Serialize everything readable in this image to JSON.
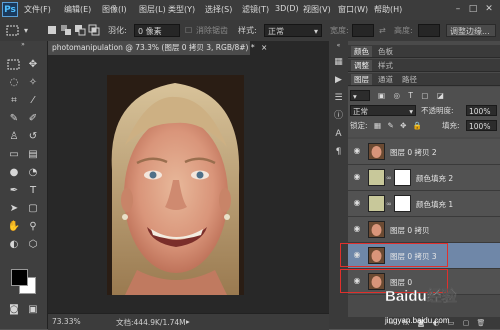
{
  "app": {
    "logo": "Ps"
  },
  "menubar": {
    "items": [
      "文件(F)",
      "编辑(E)",
      "图像(I)",
      "图层(L)",
      "类型(Y)",
      "选择(S)",
      "滤镜(T)",
      "3D(D)",
      "视图(V)",
      "窗口(W)",
      "帮助(H)"
    ],
    "window_buttons": [
      "–",
      "□",
      "✕"
    ]
  },
  "options_bar": {
    "feather_label": "羽化:",
    "feather_value": "0 像素",
    "antialias_label": "消除锯齿",
    "style_label": "样式:",
    "style_value": "正常",
    "width_label": "宽度:",
    "height_label": "高度:",
    "refine_edge_label": "调整边缘..."
  },
  "document": {
    "tab_title": "photomanipulation @ 73.3% (图层 0 拷贝 3, RGB/8#) *",
    "tab_close": "×",
    "zoom": "73.33%",
    "doc_size": "文档:444.9K/1.74M"
  },
  "panels": {
    "top_tabs": [
      "颜色",
      "色板"
    ],
    "mid_tabs": [
      "调整",
      "样式"
    ],
    "layer_tabs": [
      "图层",
      "通道",
      "路径"
    ],
    "blend_mode": "正常",
    "opacity_label": "不透明度:",
    "opacity_value": "100%",
    "lock_label": "锁定:",
    "fill_label": "填充:",
    "fill_value": "100%",
    "layers": [
      {
        "name": "图层 0 拷贝 2",
        "thumb": "face",
        "selected": false,
        "boxed": false
      },
      {
        "name": "颜色填充 2",
        "thumb": "fill",
        "selected": false,
        "boxed": false
      },
      {
        "name": "颜色填充 1",
        "thumb": "fill",
        "selected": false,
        "boxed": false
      },
      {
        "name": "图层 0 拷贝",
        "thumb": "face",
        "selected": false,
        "boxed": false
      },
      {
        "name": "图层 0 拷贝 3",
        "thumb": "face",
        "selected": true,
        "boxed": true
      },
      {
        "name": "图层 0",
        "thumb": "face",
        "selected": false,
        "boxed": true
      }
    ],
    "footer_icons": [
      "link-icon",
      "fx-icon",
      "mask-icon",
      "adjustment-icon",
      "folder-icon",
      "new-layer-icon",
      "trash-icon"
    ]
  },
  "watermark": {
    "text": "Baidu经验",
    "subtext": "jingyan.baidu.com"
  },
  "colors": {
    "accent_selected": "#6f87a8",
    "highlight_box": "#e0302c",
    "fill_thumb": "#c8c89a"
  }
}
